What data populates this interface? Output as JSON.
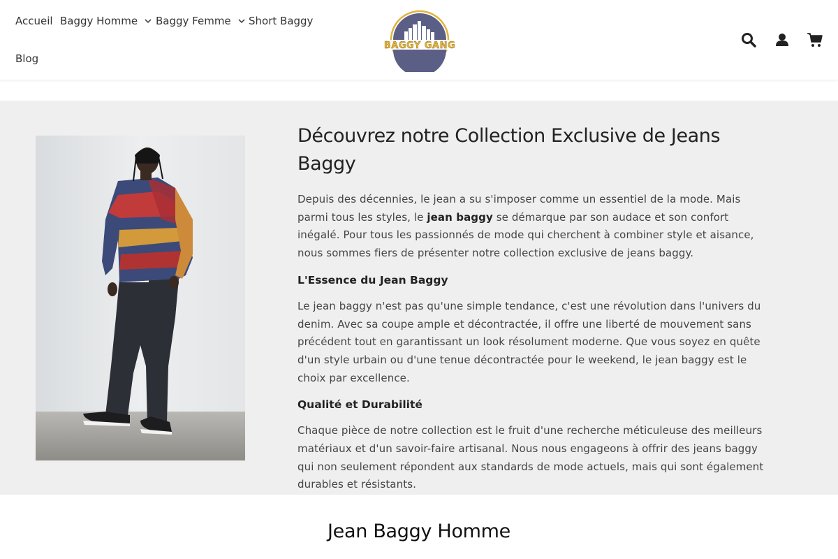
{
  "nav": {
    "items": [
      {
        "label": "Accueil"
      },
      {
        "label": "Baggy Homme"
      },
      {
        "label": "Baggy Femme"
      },
      {
        "label": "Short Baggy"
      },
      {
        "label": "Blog"
      }
    ]
  },
  "logo": {
    "text": "BAGGY GANG"
  },
  "header_icons": [
    "search-icon",
    "user-icon",
    "cart-icon"
  ],
  "intro": {
    "title": "Découvrez notre Collection Exclusive de Jeans Baggy",
    "p1_before": "Depuis des décennies, le jean a su s'imposer comme un essentiel de la mode. Mais parmi tous les styles, le ",
    "p1_bold": "jean baggy",
    "p1_after": " se démarque par son audace et son confort inégalé. Pour tous les passionnés de mode qui cherchent à combiner style et aisance, nous sommes fiers de présenter notre collection exclusive de jeans baggy.",
    "h2": "L'Essence du Jean Baggy",
    "p2": "Le jean baggy n'est pas qu'une simple tendance, c'est une révolution dans l'univers du denim. Avec sa coupe ample et décontractée, il offre une liberté de mouvement sans précédent tout en garantissant un look résolument moderne. Que vous soyez en quête d'un style urbain ou d'une tenue décontractée pour le weekend, le jean baggy est le choix par excellence.",
    "h3": "Qualité et Durabilité",
    "p3": "Chaque pièce de notre collection est le fruit d'une recherche méticuleuse des meilleurs matériaux et d'un savoir-faire artisanal. Nous nous engageons à offrir des jeans baggy qui non seulement répondent aux standards de mode actuels, mais qui sont également durables et résistants."
  },
  "section": {
    "title": "Jean Baggy Homme"
  },
  "colors": {
    "intro_bg": "#efefef",
    "logo_blue": "#5b5f86",
    "logo_gold": "#e2b23a"
  }
}
